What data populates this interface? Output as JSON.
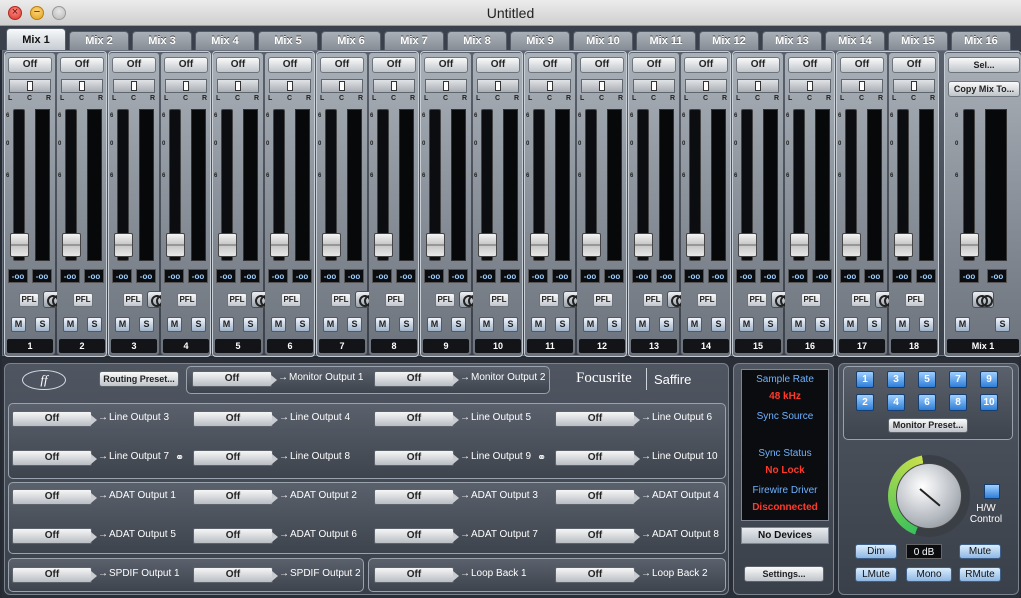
{
  "window": {
    "title": "Untitled"
  },
  "tabs": [
    "Mix 1",
    "Mix 2",
    "Mix 3",
    "Mix 4",
    "Mix 5",
    "Mix 6",
    "Mix 7",
    "Mix 8",
    "Mix 9",
    "Mix 10",
    "Mix 11",
    "Mix 12",
    "Mix 13",
    "Mix 14",
    "Mix 15",
    "Mix 16"
  ],
  "active_tab": "Mix 1",
  "strip": {
    "off_label": "Off",
    "pan_labels": [
      "L",
      "C",
      "R"
    ],
    "scale": [
      "6",
      "0",
      "6"
    ],
    "level_a": "-oo",
    "level_b": "-oo",
    "pfl_label": "PFL",
    "mute_label": "M",
    "solo_label": "S"
  },
  "channels": [
    "1",
    "2",
    "3",
    "4",
    "5",
    "6",
    "7",
    "8",
    "9",
    "10",
    "11",
    "12",
    "13",
    "14",
    "15",
    "16",
    "17",
    "18"
  ],
  "master": {
    "select_label": "Sel...",
    "copy_label": "Copy Mix To...",
    "number": "Mix 1"
  },
  "routing": {
    "preset_label": "Routing Preset...",
    "monitor_outputs": [
      {
        "value": "Off",
        "label": "Monitor Output 1"
      },
      {
        "value": "Off",
        "label": "Monitor Output 2"
      }
    ],
    "line_outputs": [
      {
        "value": "Off",
        "label": "Line Output 3"
      },
      {
        "value": "Off",
        "label": "Line Output 4"
      },
      {
        "value": "Off",
        "label": "Line Output 5"
      },
      {
        "value": "Off",
        "label": "Line Output 6"
      },
      {
        "value": "Off",
        "label": "Line Output 7"
      },
      {
        "value": "Off",
        "label": "Line Output 8"
      },
      {
        "value": "Off",
        "label": "Line Output 9"
      },
      {
        "value": "Off",
        "label": "Line Output 10"
      }
    ],
    "adat_outputs": [
      {
        "value": "Off",
        "label": "ADAT Output 1"
      },
      {
        "value": "Off",
        "label": "ADAT Output 2"
      },
      {
        "value": "Off",
        "label": "ADAT Output 3"
      },
      {
        "value": "Off",
        "label": "ADAT Output 4"
      },
      {
        "value": "Off",
        "label": "ADAT Output 5"
      },
      {
        "value": "Off",
        "label": "ADAT Output 6"
      },
      {
        "value": "Off",
        "label": "ADAT Output 7"
      },
      {
        "value": "Off",
        "label": "ADAT Output 8"
      }
    ],
    "spdif_outputs": [
      {
        "value": "Off",
        "label": "SPDIF Output 1"
      },
      {
        "value": "Off",
        "label": "SPDIF Output 2"
      }
    ],
    "loopback_outputs": [
      {
        "value": "Off",
        "label": "Loop Back 1"
      },
      {
        "value": "Off",
        "label": "Loop Back 2"
      }
    ]
  },
  "brand": {
    "logo": "ff",
    "name": "Focusrite",
    "product": "Saffire"
  },
  "status": {
    "sample_rate_label": "Sample Rate",
    "sample_rate": "48 kHz",
    "sync_source_label": "Sync Source",
    "sync_source": "",
    "sync_status_label": "Sync Status",
    "sync_status": "No Lock",
    "firewire_label": "Firewire Driver",
    "firewire_status": "Disconnected",
    "devices_label": "No Devices",
    "settings_label": "Settings..."
  },
  "monitor": {
    "buttons_top": [
      "1",
      "3",
      "5",
      "7",
      "9"
    ],
    "buttons_bottom": [
      "2",
      "4",
      "6",
      "8",
      "10"
    ],
    "preset_label": "Monitor Preset...",
    "hw_control_label": "H/W Control",
    "dim_label": "Dim",
    "level": "0 dB",
    "mute_label": "Mute",
    "lmute_label": "LMute",
    "mono_label": "Mono",
    "rmute_label": "RMute"
  },
  "colors": {
    "status_red": "#ff3a2a",
    "status_blue": "#6fb2ff",
    "monitor_blue": "#2f7ed8"
  },
  "icons": {
    "headphone": "headphone-icon",
    "link": "link-icon"
  }
}
